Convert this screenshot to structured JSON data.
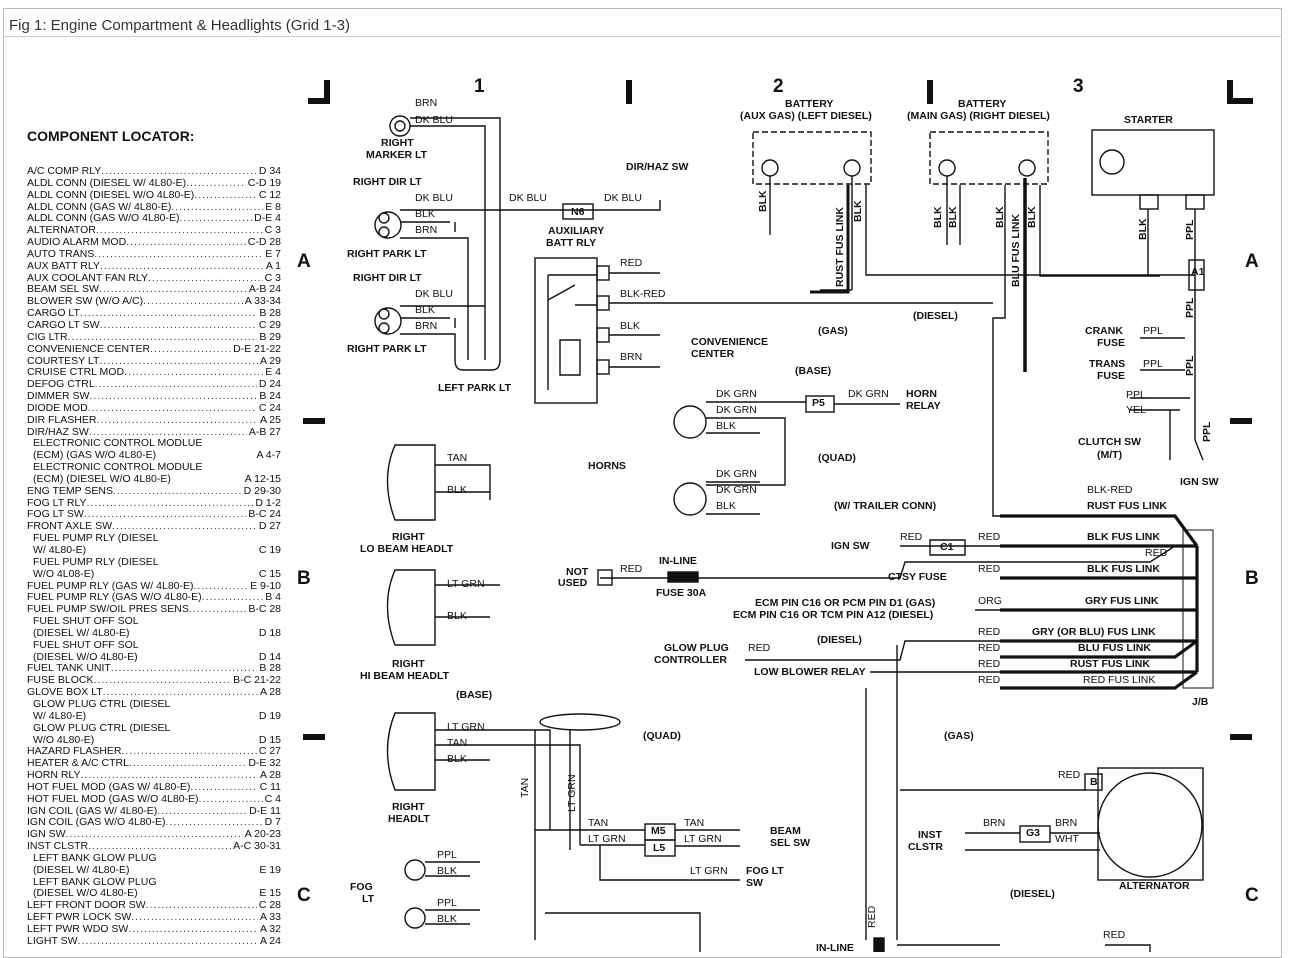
{
  "window": {
    "title": "Fig 1: Engine Compartment & Headlights (Grid 1-3)"
  },
  "locator": {
    "title": "COMPONENT LOCATOR:",
    "items": [
      {
        "name": "A/C COMP RLY",
        "ref": "D 34"
      },
      {
        "name": "ALDL CONN (DIESEL W/ 4L80-E)",
        "ref": "C-D 19"
      },
      {
        "name": "ALDL CONN (DIESEL W/O 4L80-E)",
        "ref": "C 12"
      },
      {
        "name": "ALDL CONN (GAS W/ 4L80-E)",
        "ref": "E 8"
      },
      {
        "name": "ALDL CONN (GAS W/O 4L80-E)",
        "ref": "D-E 4"
      },
      {
        "name": "ALTERNATOR",
        "ref": "C 3"
      },
      {
        "name": "AUDIO ALARM MOD",
        "ref": "C-D 28"
      },
      {
        "name": "AUTO TRANS",
        "ref": "E 7"
      },
      {
        "name": "AUX BATT RLY",
        "ref": "A 1"
      },
      {
        "name": "AUX COOLANT FAN RLY",
        "ref": "C 3"
      },
      {
        "name": "BEAM SEL SW",
        "ref": "A-B 24"
      },
      {
        "name": "BLOWER SW (W/O A/C)",
        "ref": "A 33-34"
      },
      {
        "name": "CARGO LT",
        "ref": "B 28"
      },
      {
        "name": "CARGO LT SW",
        "ref": "C 29"
      },
      {
        "name": "CIG LTR",
        "ref": "B 29"
      },
      {
        "name": "CONVENIENCE CENTER",
        "ref": "D-E 21-22"
      },
      {
        "name": "COURTESY  LT",
        "ref": "A 29"
      },
      {
        "name": "CRUISE CTRL MOD",
        "ref": "E 4"
      },
      {
        "name": "DEFOG CTRL",
        "ref": "D 24"
      },
      {
        "name": "DIMMER SW",
        "ref": "B 24"
      },
      {
        "name": "DIODE MOD",
        "ref": "C 24"
      },
      {
        "name": "DIR FLASHER",
        "ref": "A 25"
      },
      {
        "name": "DIR/HAZ SW",
        "ref": "A-B 27"
      },
      {
        "name": "ELECTRONIC CONTROL MODLUE",
        "ref": ""
      },
      {
        "name": "(ECM) (GAS W/O 4L80-E)",
        "ref": "A 4-7",
        "cont": true
      },
      {
        "name": "ELECTRONIC CONTROL MODULE",
        "ref": ""
      },
      {
        "name": "(ECM) (DIESEL W/O 4L80-E)",
        "ref": "A 12-15",
        "cont": true
      },
      {
        "name": "ENG TEMP SENS",
        "ref": "D 29-30"
      },
      {
        "name": "FOG LT RLY",
        "ref": "D 1-2"
      },
      {
        "name": "FOG LT SW",
        "ref": "B-C 24"
      },
      {
        "name": "FRONT AXLE SW",
        "ref": "D 27"
      },
      {
        "name": "FUEL PUMP RLY (DIESEL",
        "ref": ""
      },
      {
        "name": "W/ 4L80-E)",
        "ref": "C 19",
        "cont": true
      },
      {
        "name": "FUEL PUMP RLY (DIESEL",
        "ref": ""
      },
      {
        "name": "W/O 4L08-E)",
        "ref": "C 15",
        "cont": true
      },
      {
        "name": "FUEL PUMP RLY (GAS W/ 4L80-E)",
        "ref": "E 9-10"
      },
      {
        "name": "FUEL PUMP RLY (GAS W/O 4L80-E)",
        "ref": "B 4"
      },
      {
        "name": "FUEL PUMP SW/OIL PRES SENS",
        "ref": "B-C 28"
      },
      {
        "name": "FUEL SHUT OFF SOL",
        "ref": ""
      },
      {
        "name": "(DIESEL W/ 4L80-E)",
        "ref": "D 18",
        "cont": true
      },
      {
        "name": "FUEL SHUT OFF SOL",
        "ref": ""
      },
      {
        "name": "(DIESEL W/O 4L80-E)",
        "ref": "D 14",
        "cont": true
      },
      {
        "name": "FUEL TANK UNIT",
        "ref": "B 28"
      },
      {
        "name": "FUSE BLOCK",
        "ref": "B-C 21-22"
      },
      {
        "name": "GLOVE BOX LT",
        "ref": "A 28"
      },
      {
        "name": "GLOW PLUG CTRL (DIESEL",
        "ref": ""
      },
      {
        "name": "W/ 4L80-E)",
        "ref": "D 19",
        "cont": true
      },
      {
        "name": "GLOW PLUG CTRL (DIESEL",
        "ref": ""
      },
      {
        "name": "W/O 4L80-E)",
        "ref": "D 15",
        "cont": true
      },
      {
        "name": "HAZARD FLASHER",
        "ref": "C 27"
      },
      {
        "name": "HEATER & A/C CTRL",
        "ref": "D-E 32"
      },
      {
        "name": "HORN RLY",
        "ref": "A 28"
      },
      {
        "name": "HOT FUEL MOD (GAS W/ 4L80-E)",
        "ref": "C 11"
      },
      {
        "name": "HOT FUEL MOD (GAS W/O 4L80-E)",
        "ref": "C 4"
      },
      {
        "name": "IGN COIL (GAS W/ 4L80-E)",
        "ref": "D-E 11"
      },
      {
        "name": "IGN COIL (GAS W/O 4L80-E)",
        "ref": "D 7"
      },
      {
        "name": "IGN SW",
        "ref": "A 20-23"
      },
      {
        "name": "INST CLSTR",
        "ref": "A-C 30-31"
      },
      {
        "name": "LEFT BANK GLOW PLUG",
        "ref": ""
      },
      {
        "name": "(DIESEL W/ 4L80-E)",
        "ref": "E 19",
        "cont": true
      },
      {
        "name": "LEFT BANK GLOW PLUG",
        "ref": ""
      },
      {
        "name": "(DIESEL W/O 4L80-E)",
        "ref": "E 15",
        "cont": true
      },
      {
        "name": "LEFT FRONT DOOR SW",
        "ref": "C 28"
      },
      {
        "name": "LEFT PWR LOCK SW",
        "ref": "A 33"
      },
      {
        "name": "LEFT PWR WDO SW",
        "ref": "A 32"
      },
      {
        "name": "LIGHT SW",
        "ref": "A 24"
      }
    ]
  },
  "grid": {
    "columns": [
      "1",
      "2",
      "3"
    ],
    "rows": [
      "A",
      "B",
      "C"
    ]
  },
  "diagram": {
    "labels": {
      "brn_marker": "BRN",
      "dkblu_marker": "DK BLU",
      "right_marker_1": "RIGHT",
      "right_marker_2": "MARKER LT",
      "right_dir_1": "RIGHT DIR LT",
      "dkblu_1": "DK BLU",
      "blk_1": "BLK",
      "brn_1": "BRN",
      "dkblu_n6_in": "DK BLU",
      "n6": "N6",
      "dkblu_n6_out": "DK BLU",
      "dir_haz_sw": "DIR/HAZ SW",
      "right_park_1": "RIGHT PARK LT",
      "right_dir_2": "RIGHT DIR LT",
      "dkblu_2": "DK BLU",
      "blk_2": "BLK",
      "brn_2": "BRN",
      "right_park_2": "RIGHT PARK LT",
      "left_park": "LEFT PARK LT",
      "aux_batt_1": "AUXILIARY",
      "aux_batt_2": "BATT RLY",
      "relay_red": "RED",
      "relay_blkred": "BLK-RED",
      "relay_blk": "BLK",
      "relay_brn": "BRN",
      "conv_1": "CONVENIENCE",
      "conv_2": "CENTER",
      "battery_aux_1": "BATTERY",
      "battery_aux_2": "(AUX GAS) (LEFT DIESEL)",
      "battery_main_1": "BATTERY",
      "battery_main_2": "(MAIN GAS) (RIGHT DIESEL)",
      "starter": "STARTER",
      "v_blk_aux": "BLK",
      "v_rust": "RUST FUS LINK",
      "v_blk_aux2": "BLK",
      "v_blk_m1": "BLK",
      "v_blk_m2": "BLK",
      "v_blk_m3": "BLK",
      "v_blu": "BLU FUS LINK",
      "v_blk_m4": "BLK",
      "v_blk_st": "BLK",
      "v_ppl_st": "PPL",
      "v_ppl_a1": "PPL",
      "v_ppl_fuse": "PPL",
      "v_ppl_clutch": "PPL",
      "gas": "(GAS)",
      "diesel": "(DIESEL)",
      "a1": "A1",
      "crank_1": "CRANK",
      "crank_2": "FUSE",
      "crank_ppl": "PPL",
      "trans_1": "TRANS",
      "trans_2": "FUSE",
      "trans_ppl": "PPL",
      "clutch_ppl": "PPL",
      "clutch_yel": "YEL",
      "clutch_1": "CLUTCH SW",
      "clutch_2": "(M/T)",
      "ign_sw_top": "IGN SW",
      "base_horn": "(BASE)",
      "dkgrn_1": "DK GRN",
      "dkgrn_2": "DK GRN",
      "horn_blk_1": "BLK",
      "p5": "P5",
      "dkgrn_relay": "DK GRN",
      "horn_relay_1": "HORN",
      "horn_relay_2": "RELAY",
      "horns": "HORNS",
      "quad_horn": "(QUAD)",
      "dkgrn_3": "DK GRN",
      "dkgrn_4": "DK GRN",
      "horn_blk_2": "BLK",
      "trailer": "(W/ TRAILER CONN)",
      "blk_red_jb": "BLK-RED",
      "rust_fus_1": "RUST FUS LINK",
      "ign_sw": "IGN SW",
      "c1_red_in": "RED",
      "c1": "C1",
      "c1_red_out": "RED",
      "blk_fus_1": "BLK FUS LINK",
      "red_jb": "RED",
      "not_used_1": "NOT",
      "not_used_2": "USED",
      "inline_red": "RED",
      "inline_1": "IN-LINE",
      "inline_2": "FUSE 30A",
      "ctsy_fuse": "CTSY FUSE",
      "ctsy_red": "RED",
      "blk_fus_2": "BLK FUS LINK",
      "ecm_1": "ECM PIN C16 OR PCM PIN D1 (GAS)",
      "ecm_2": "ECM PIN C16 OR TCM PIN A12 (DIESEL)",
      "ecm_org": "ORG",
      "gry_fus": "GRY FUS LINK",
      "glow_1": "GLOW PLUG",
      "glow_2": "CONTROLLER",
      "glow_red": "RED",
      "glow_diesel": "(DIESEL)",
      "low_blower": "LOW BLOWER RELAY",
      "red_a": "RED",
      "gry_blu_fus": "GRY (OR BLU) FUS LINK",
      "red_b": "RED",
      "blu_fus": "BLU FUS LINK",
      "red_c": "RED",
      "rust_fus_2": "RUST FUS LINK",
      "red_d": "RED",
      "red_fus": "RED FUS LINK",
      "jb": "J/B",
      "lo_tan": "TAN",
      "lo_blk": "BLK",
      "lo_1": "RIGHT",
      "lo_2": "LO BEAM HEADLT",
      "hi_ltgrn": "LT GRN",
      "hi_blk": "BLK",
      "hi_1": "RIGHT",
      "hi_2": "HI BEAM HEADLT",
      "base_hl": "(BASE)",
      "hl_ltgrn": "LT GRN",
      "hl_tan": "TAN",
      "hl_blk": "BLK",
      "quad_hl": "(QUAD)",
      "hl_1": "RIGHT",
      "hl_2": "HEADLT",
      "gas_2": "(GAS)",
      "v_tan": "TAN",
      "v_ltgrn": "LT GRN",
      "m5_tan_in": "TAN",
      "m5_ltgrn_in": "LT GRN",
      "m5": "M5",
      "l5": "L5",
      "m5_tan_out": "TAN",
      "m5_ltgrn_out": "LT GRN",
      "beam_1": "BEAM",
      "beam_2": "SEL SW",
      "fog_ltgrn": "LT GRN",
      "fogsw_1": "FOG LT",
      "fogsw_2": "SW",
      "alt_red": "RED",
      "alt_b": "B",
      "inst_1": "INST",
      "inst_2": "CLSTR",
      "g3_brn_in": "BRN",
      "g3": "G3",
      "g3_brn_out": "BRN",
      "g3_wht": "WHT",
      "alternator": "ALTERNATOR",
      "alt_diesel": "(DIESEL)",
      "fog_ppl_1": "PPL",
      "fog_blk_1": "BLK",
      "fog_1": "FOG",
      "fog_2": "LT",
      "fog_ppl_2": "PPL",
      "fog_blk_2": "BLK",
      "v_red_bottom": "RED",
      "inline_bottom": "IN-LINE",
      "red_bottom": "RED"
    }
  }
}
